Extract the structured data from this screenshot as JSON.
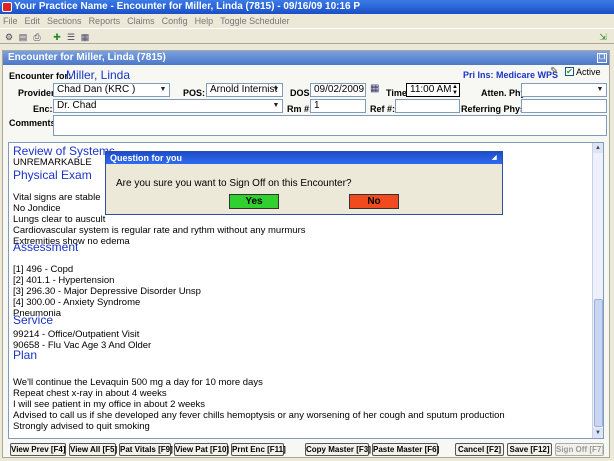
{
  "app": {
    "title": "Your Practice Name  -  Encounter for Miller, Linda (7815) - 09/16/09 10:16 P",
    "menu": [
      "File",
      "Edit",
      "Sections",
      "Reports",
      "Claims",
      "Config",
      "Help",
      "Toggle Scheduler"
    ]
  },
  "encounter": {
    "window_title": "Encounter for Miller, Linda (7815)",
    "encounter_for_label": "Encounter for:",
    "patient_name": "Miller, Linda",
    "pri_ins": "Pri Ins: Medicare WPS",
    "active_label": "Active",
    "active_checked": true,
    "provider_label": "Provider:",
    "provider_value": "Chad Dan (KRC )",
    "pos_label": "POS:",
    "pos_value": "Arnold Internist",
    "dos_label": "DOS:",
    "dos_value": "09/02/2009",
    "time_label": "Time:",
    "time_value": "11:00 AM",
    "atten_label": "Atten. Phys:",
    "atten_value": "",
    "enc_label": "Enc:",
    "enc_value": "Dr. Chad",
    "rm_label": "Rm #:",
    "rm_value": "1",
    "ref_label": "Ref #:",
    "ref_value": "",
    "referring_label": "Referring Phys:",
    "referring_value": "",
    "comments_label": "Comments:",
    "comments_value": ""
  },
  "note": {
    "review_heading": "Review of Systems",
    "review_lines": [
      "UNREMARKABLE"
    ],
    "exam_heading": "Physical Exam",
    "exam_lines": [
      "Vital signs are stable",
      "No Jondice",
      "Lungs clear to auscult",
      "Cardiovascular system is regular rate and rythm without any murmurs",
      "Extremities show no edema"
    ],
    "assessment_heading": "Assessment",
    "assessment_lines": [
      "[1] 496 - Copd",
      "[2] 401.1 - Hypertension",
      "[3] 296.30 - Major Depressive Disorder Unsp",
      "[4] 300.00 - Anxiety Syndrome",
      "Pneumonia"
    ],
    "service_heading": "Service",
    "service_lines": [
      "99214 - Office/Outpatient Visit",
      "90658 - Flu Vac Age 3 And Older"
    ],
    "plan_heading": "Plan",
    "plan_lines": [
      "We'll continue the Levaquin 500 mg a day for 10 more days",
      "Repeat chest x-ray in about 4 weeks",
      "I will see patient in my office in about 2 weeks",
      "Advised to call us if she developed any fever chills hemoptysis or any worsening of her cough and sputum production",
      "Strongly advised to quit smoking"
    ]
  },
  "buttons": {
    "view_prev": "View Prev [F4]",
    "view_all": "View All [F5]",
    "pat_vitals": "Pat Vitals [F9]",
    "view_pat": "View Pat [F10]",
    "prnt_enc": "Prnt Enc [F11]",
    "copy_master": "Copy Master [F3]",
    "paste_master": "Paste Master [F6]",
    "cancel": "Cancel [F2]",
    "save": "Save [F12]",
    "sign_off": "Sign Off [F7]"
  },
  "dialog": {
    "title": "Question for you",
    "message": "Are you sure you want to Sign Off on this Encounter?",
    "yes": "Yes",
    "no": "No"
  },
  "colors": {
    "accent_blue": "#1a34c8",
    "yes_green": "#2fd02f",
    "no_red": "#f04a1e"
  }
}
